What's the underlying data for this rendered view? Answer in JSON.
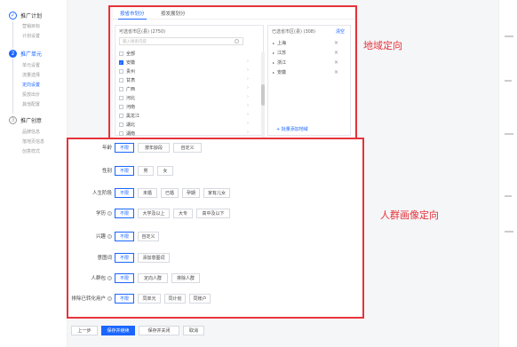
{
  "sidebar": {
    "steps": [
      {
        "num": "✓",
        "title": "推广计划",
        "subs": [
          "营销目标",
          "计划设置"
        ]
      },
      {
        "num": "2",
        "title": "推广单元",
        "subs": [
          "单元设置",
          "流量选择",
          "定向设置",
          "投放出价",
          "其他配置"
        ]
      },
      {
        "num": "3",
        "title": "推广创意",
        "subs": [
          "品牌信息",
          "落地页信息",
          "创意样式"
        ]
      }
    ]
  },
  "region": {
    "tabs": [
      "按省市划分",
      "按发展划分"
    ],
    "available_title": "可选省市区(县) (2750)",
    "search_placeholder": "输入搜索内容",
    "provinces": [
      "全部",
      "安徽",
      "贵州",
      "甘肃",
      "广西",
      "河北",
      "河南",
      "黑龙江",
      "湖北",
      "湖南"
    ],
    "selected_title": "已选省市区(县) (308)",
    "clear_label": "清空",
    "selected": [
      "上海",
      "江苏",
      "浙江",
      "安徽"
    ],
    "batch_add_label": "+ 批量添加地域"
  },
  "crowd": {
    "rows": [
      {
        "label": "年龄",
        "help": false,
        "options": [
          "不限",
          "按年龄段",
          "自定义"
        ]
      },
      {
        "label": "性别",
        "help": false,
        "options": [
          "不限",
          "男",
          "女"
        ]
      },
      {
        "label": "人生阶段",
        "help": false,
        "options": [
          "不限",
          "未婚",
          "已婚",
          "孕期",
          "家有儿女"
        ]
      },
      {
        "label": "学历",
        "help": true,
        "options": [
          "不限",
          "大学及以上",
          "大专",
          "高中及以下"
        ]
      },
      {
        "label": "兴趣",
        "help": true,
        "options": [
          "不限",
          "自定义"
        ]
      },
      {
        "label": "意图词",
        "help": false,
        "options": [
          "不限",
          "添加意图词"
        ]
      },
      {
        "label": "人群包",
        "help": true,
        "options": [
          "不限",
          "定向人群",
          "排除人群"
        ]
      },
      {
        "label": "排除已转化用户",
        "help": true,
        "options": [
          "不限",
          "同单元",
          "同计划",
          "同账户"
        ]
      }
    ]
  },
  "footer": {
    "prev": "上一步",
    "save_continue": "保存并继续",
    "save_close": "保存并关闭",
    "cancel": "取消"
  },
  "annotations": {
    "region": "地域定向",
    "crowd": "人群画像定向"
  },
  "colors": {
    "accent": "#1a66ff",
    "annotation": "#e5333a"
  }
}
